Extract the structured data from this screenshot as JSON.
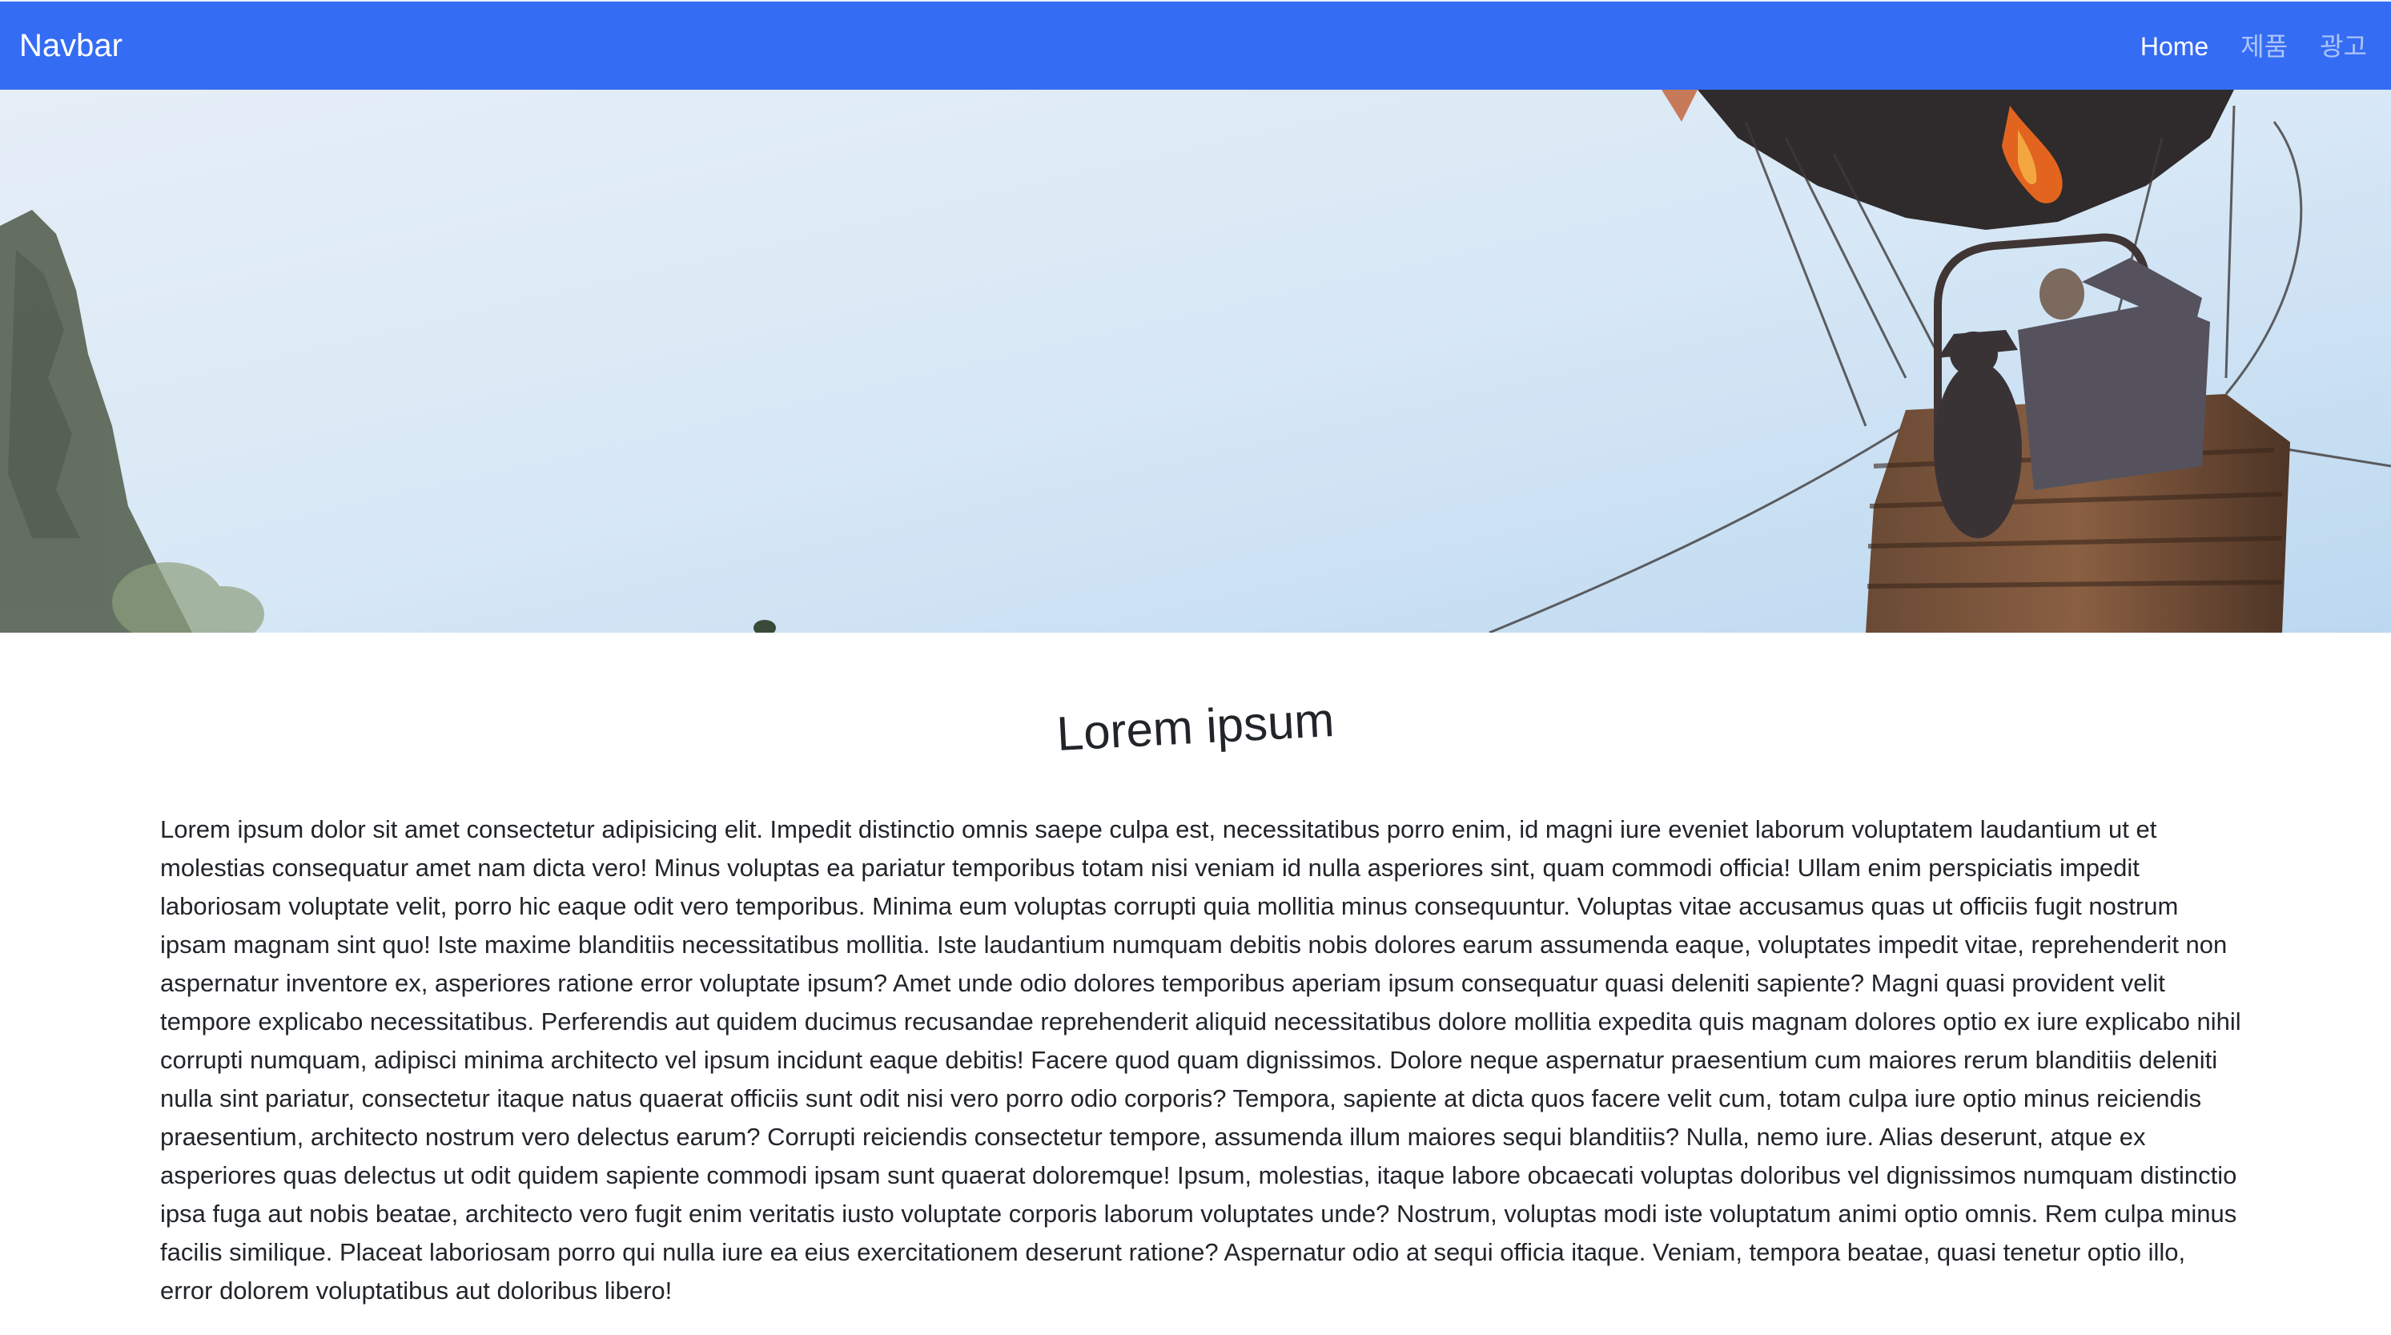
{
  "navbar": {
    "brand": "Navbar",
    "links": [
      {
        "label": "Home",
        "active": true
      },
      {
        "label": "제품",
        "active": false
      },
      {
        "label": "광고",
        "active": false
      }
    ],
    "background_color": "#346cf3"
  },
  "hero": {
    "image_subject": "hot-air-balloon-basket-photo"
  },
  "main": {
    "title": "Lorem ipsum",
    "paragraph": "Lorem ipsum dolor sit amet consectetur adipisicing elit. Impedit distinctio omnis saepe culpa est, necessitatibus porro enim, id magni iure eveniet laborum voluptatem laudantium ut et molestias consequatur amet nam dicta vero! Minus voluptas ea pariatur temporibus totam nisi veniam id nulla asperiores sint, quam commodi officia! Ullam enim perspiciatis impedit laboriosam voluptate velit, porro hic eaque odit vero temporibus. Minima eum voluptas corrupti quia mollitia minus consequuntur. Voluptas vitae accusamus quas ut officiis fugit nostrum ipsam magnam sint quo! Iste maxime blanditiis necessitatibus mollitia. Iste laudantium numquam debitis nobis dolores earum assumenda eaque, voluptates impedit vitae, reprehenderit non aspernatur inventore ex, asperiores ratione error voluptate ipsum? Amet unde odio dolores temporibus aperiam ipsum consequatur quasi deleniti sapiente? Magni quasi provident velit tempore explicabo necessitatibus. Perferendis aut quidem ducimus recusandae reprehenderit aliquid necessitatibus dolore mollitia expedita quis magnam dolores optio ex iure explicabo nihil corrupti numquam, adipisci minima architecto vel ipsum incidunt eaque debitis! Facere quod quam dignissimos. Dolore neque aspernatur praesentium cum maiores rerum blanditiis deleniti nulla sint pariatur, consectetur itaque natus quaerat officiis sunt odit nisi vero porro odio corporis? Tempora, sapiente at dicta quos facere velit cum, totam culpa iure optio minus reiciendis praesentium, architecto nostrum vero delectus earum? Corrupti reiciendis consectetur tempore, assumenda illum maiores sequi blanditiis? Nulla, nemo iure. Alias deserunt, atque ex asperiores quas delectus ut odit quidem sapiente commodi ipsam sunt quaerat doloremque! Ipsum, molestias, itaque labore obcaecati voluptas doloribus vel dignissimos numquam distinctio ipsa fuga aut nobis beatae, architecto vero fugit enim veritatis iusto voluptate corporis laborum voluptates unde? Nostrum, voluptas modi iste voluptatum animi optio omnis. Rem culpa minus facilis similique. Placeat laboriosam porro qui nulla iure ea eius exercitationem deserunt ratione? Aspernatur odio at sequi officia itaque. Veniam, tempora beatae, quasi tenetur optio illo, error dolorem voluptatibus aut doloribus libero!"
  }
}
